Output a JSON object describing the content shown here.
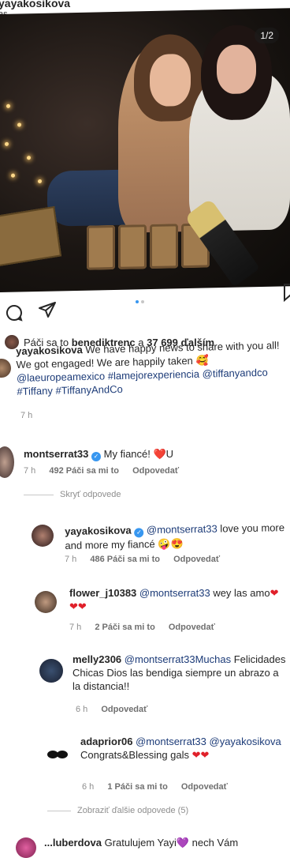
{
  "post": {
    "username": "yayakosikova",
    "location": "as",
    "photo_counter": "1/2",
    "likes_text_prefix": "Páči sa to",
    "likes_user": "benediktrenc",
    "likes_text_mid": "a",
    "likes_count": "37 699 ďalším",
    "caption": {
      "username": "yayakosikova",
      "text1": " We have happy news to share with you all! We got engaged! We are happily taken 🥰 ",
      "links": "@laeuropeamexico #lamejorexperiencia @tiffanyandco #Tiffany #TiffanyAndCo",
      "time": "7 h"
    }
  },
  "comments": [
    {
      "username": "montserrat33",
      "text": "My fiancé! ❤️U",
      "time": "7 h",
      "likes": "492 Páči sa mi to",
      "reply": "Odpovedať"
    }
  ],
  "hide_replies": "Skryť odpovede",
  "replies": [
    {
      "username": "yayakosikova",
      "mention": "@montserrat33",
      "text": " love you more and more my fiancé 🤪😍",
      "time": "7 h",
      "likes": "486 Páči sa mi to",
      "reply": "Odpovedať"
    },
    {
      "username": "flower_j10383",
      "mention": "@montserrat33",
      "text": " wey las amo",
      "hearts": "❤❤❤",
      "time": "7 h",
      "likes": "2 Páči sa mi to",
      "reply": "Odpovedať"
    },
    {
      "username": "melly2306",
      "mention": "@montserrat33Muchas",
      "text": " Felicidades Chicas Dios las bendiga siempre un abrazo a la distancia!!",
      "time": "6 h",
      "reply": "Odpovedať"
    },
    {
      "username": "adaprior06",
      "mention": "@montserrat33 @yayakosikova",
      "text": " Congrats&Blessing gals",
      "hearts": "❤❤",
      "time": "6 h",
      "likes": "1 Páči sa mi to",
      "reply": "Odpovedať"
    }
  ],
  "more_replies": "Zobraziť ďalšie odpovede (5)",
  "last_comment": {
    "username": "...luberdova",
    "text": "Gratulujem Yayi💜 nech Vám"
  }
}
